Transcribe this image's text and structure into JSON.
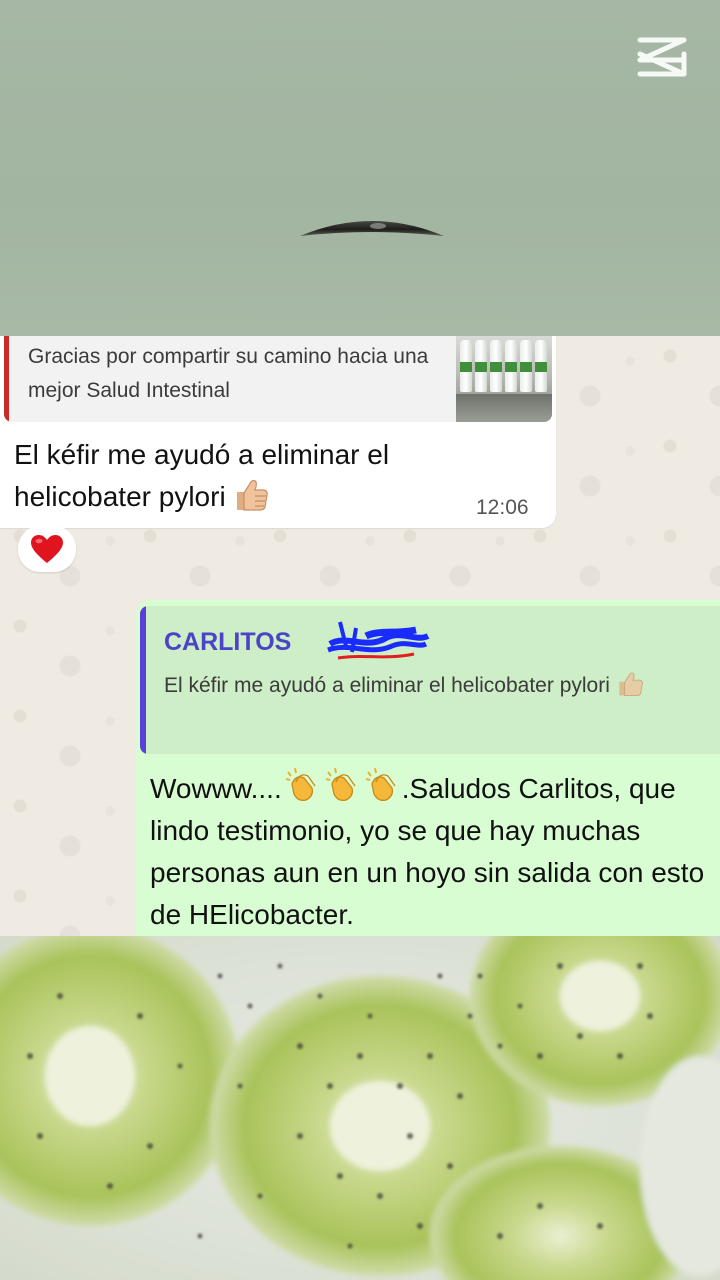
{
  "incoming": {
    "quoted_text": "Gracias por compartir su camino hacia una mejor Salud Intestinal",
    "message_text": "El kéfir me ayudó a eliminar el helicobater pylori",
    "message_emoji": "thumbs-up-icon",
    "time": "12:06",
    "reaction": "heart-icon"
  },
  "outgoing": {
    "quoted_name": "CARLITOS",
    "quoted_text": "El kéfir me ayudó a eliminar el helicobater pylori",
    "quoted_emoji": "thumbs-up-icon",
    "message_prefix": "Wowww....",
    "message_emoji": "clapping-hands-icon",
    "message_text": ".Saludos Carlitos, que lindo testimonio, yo se que hay muchas personas aun  en un hoyo sin salida con esto de HElicobacter."
  },
  "colors": {
    "incoming_bubble": "#ffffff",
    "outgoing_bubble": "#d9fdd3",
    "incoming_quote_bar": "#c92a2a",
    "outgoing_quote_bar": "#5b3fd9",
    "quoted_name_color": "#4a44c8",
    "chat_background": "#efeae2",
    "top_video_background": "#a4b7a3"
  },
  "overlay": {
    "watermark_icon": "capcut-logo-icon"
  }
}
